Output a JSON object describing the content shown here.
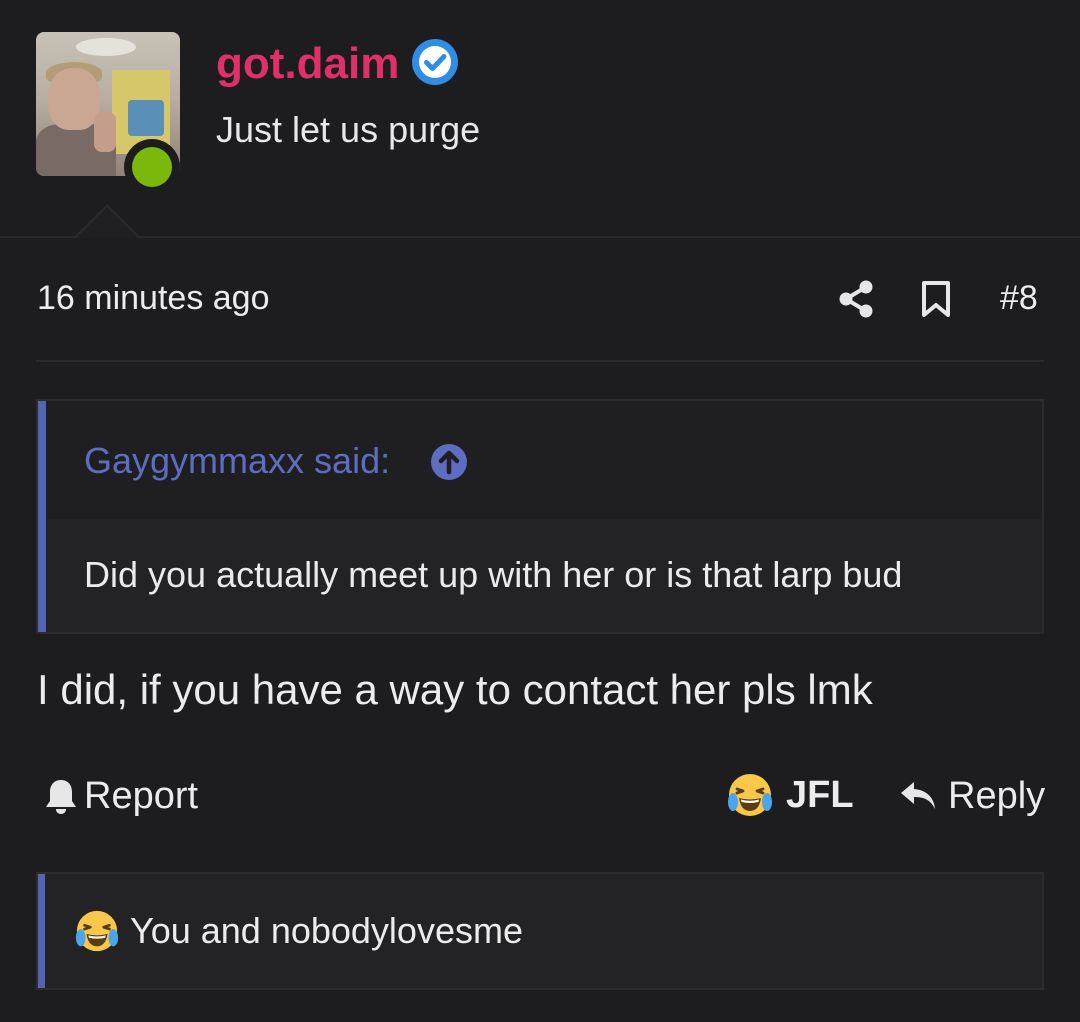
{
  "user": {
    "name": "got.daim",
    "title": "Just let us purge",
    "online": true,
    "verified": true,
    "name_color": "#e0306a"
  },
  "post": {
    "time": "16 minutes ago",
    "number": "#8",
    "message": "I did, if you have a way to contact her pls lmk"
  },
  "quote": {
    "author_line": "Gaygymmaxx said:",
    "body": "Did you actually meet up with her or is that larp bud"
  },
  "actions": {
    "report_label": "Report",
    "react_label": "JFL",
    "reply_label": "Reply"
  },
  "reactions": {
    "text": "You and nobodylovesme"
  },
  "icons": {
    "share": "share-icon",
    "bookmark": "bookmark-icon",
    "bell": "bell-icon",
    "reply": "reply-icon",
    "verified": "verified-check-icon",
    "quote_jump": "arrow-up-circle-icon",
    "reaction": "laughing-crying-emoji-icon"
  },
  "colors": {
    "background": "#1d1d1f",
    "accent": "#5465b4",
    "verified": "#2f8de4",
    "online": "#7ab80b"
  }
}
